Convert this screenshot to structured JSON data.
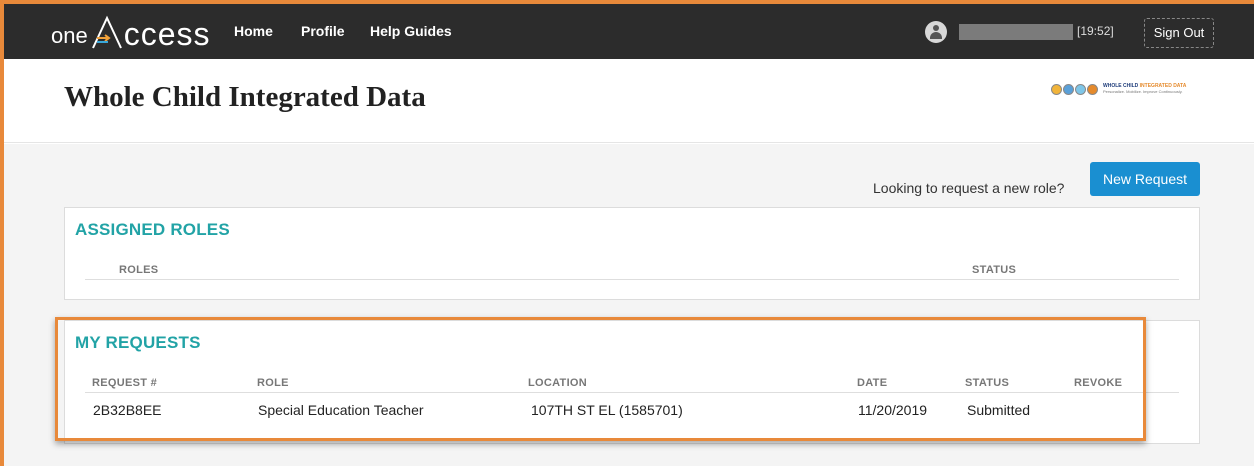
{
  "nav": {
    "logo_one": "one",
    "logo_access": "ccess",
    "links": [
      "Home",
      "Profile",
      "Help Guides"
    ],
    "time": "[19:52]",
    "sign_out": "Sign Out"
  },
  "header": {
    "title": "Whole Child Integrated Data",
    "logo_text_main": "WHOLE CHILD",
    "logo_text_accent": "INTEGRATED DATA",
    "logo_tagline": "Personalize. Mobilize. Improve Continuously."
  },
  "toolbar": {
    "new_request_prompt": "Looking to request a new role?",
    "new_request_label": "New Request"
  },
  "assigned_roles": {
    "title": "ASSIGNED ROLES",
    "columns": [
      "ROLES",
      "STATUS"
    ]
  },
  "my_requests": {
    "title": "MY REQUESTS",
    "columns": [
      "REQUEST #",
      "ROLE",
      "LOCATION",
      "DATE",
      "STATUS",
      "REVOKE"
    ],
    "rows": [
      [
        "2B32B8EE",
        "Special Education Teacher",
        "107TH ST EL (1585701)",
        "11/20/2019",
        "Submitted",
        ""
      ]
    ]
  },
  "colors": {
    "navbar": "#2c2c2c",
    "accent_teal": "#22a3a6",
    "button_blue": "#1a8fd1",
    "highlight_orange": "#e8893a"
  }
}
